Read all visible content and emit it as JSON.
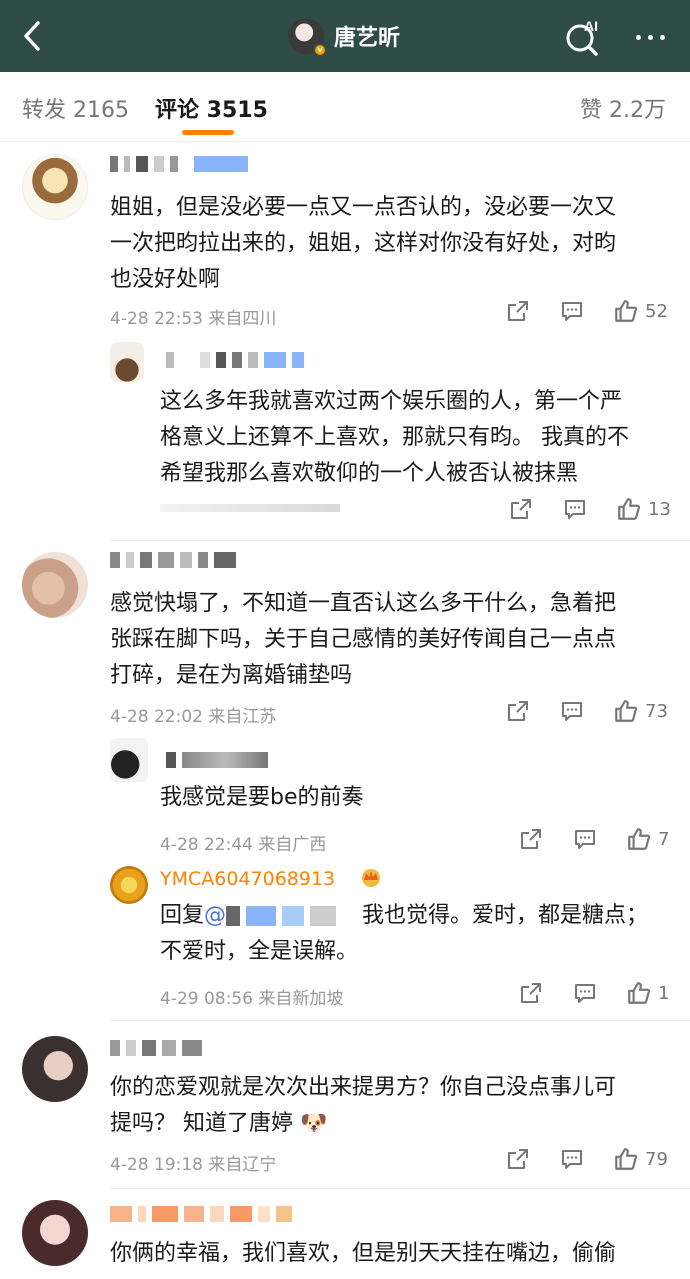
{
  "header": {
    "title": "唐艺昕",
    "ai_label": "AI"
  },
  "tabs": {
    "repost": "转发 2165",
    "comments": "评论 3515",
    "likes": "赞 2.2万"
  },
  "comments": [
    {
      "text_lines": [
        "姐姐，但是没必要一点又一点否认的，没必要一次又",
        "一次把昀拉出来的，姐姐，这样对你没有好处，对昀",
        "也没好处啊"
      ],
      "meta": "4-28 22:53  来自四川",
      "likes": "52",
      "reply": {
        "text_lines": [
          "这么多年我就喜欢过两个娱乐圈的人，第一个严",
          "格意义上还算不上喜欢，那就只有昀。 我真的不",
          "希望我那么喜欢敬仰的一个人被否认被抹黑"
        ],
        "likes": "13"
      }
    },
    {
      "text_lines": [
        "感觉快塌了，不知道一直否认这么多干什么，急着把",
        "张踩在脚下吗，关于自己感情的美好传闻自己一点点",
        "打碎，是在为离婚铺垫吗"
      ],
      "meta": "4-28 22:02  来自江苏",
      "likes": "73",
      "replies": [
        {
          "text_lines": [
            "我感觉是要be的前奏"
          ],
          "meta": "4-28 22:44  来自广西",
          "likes": "7"
        },
        {
          "name": "YMCA6047068913",
          "prefix": "回复",
          "mention": "@",
          "text_line1_end": "我也觉得。爱时，都是糖点；",
          "text_line2": "不爱时，全是误解。",
          "meta": "4-29 08:56  来自新加坡",
          "likes": "1"
        }
      ]
    },
    {
      "text_lines": [
        "你的恋爱观就是次次出来提男方？你自己没点事儿可",
        "提吗？ 知道了唐婷 🐶"
      ],
      "meta": "4-28 19:18  来自辽宁",
      "likes": "79"
    },
    {
      "text_lines": [
        "你俩的幸福，我们喜欢，但是别天天挂在嘴边，偷偷"
      ]
    }
  ],
  "colors": {
    "header_bg": "#2f4d46",
    "accent": "#ff8200",
    "mention": "#4a6ee0"
  },
  "icons": [
    "back-arrow-icon",
    "ai-search-icon",
    "more-icon",
    "share-icon",
    "comment-icon",
    "thumbs-up-icon",
    "crown-icon"
  ]
}
